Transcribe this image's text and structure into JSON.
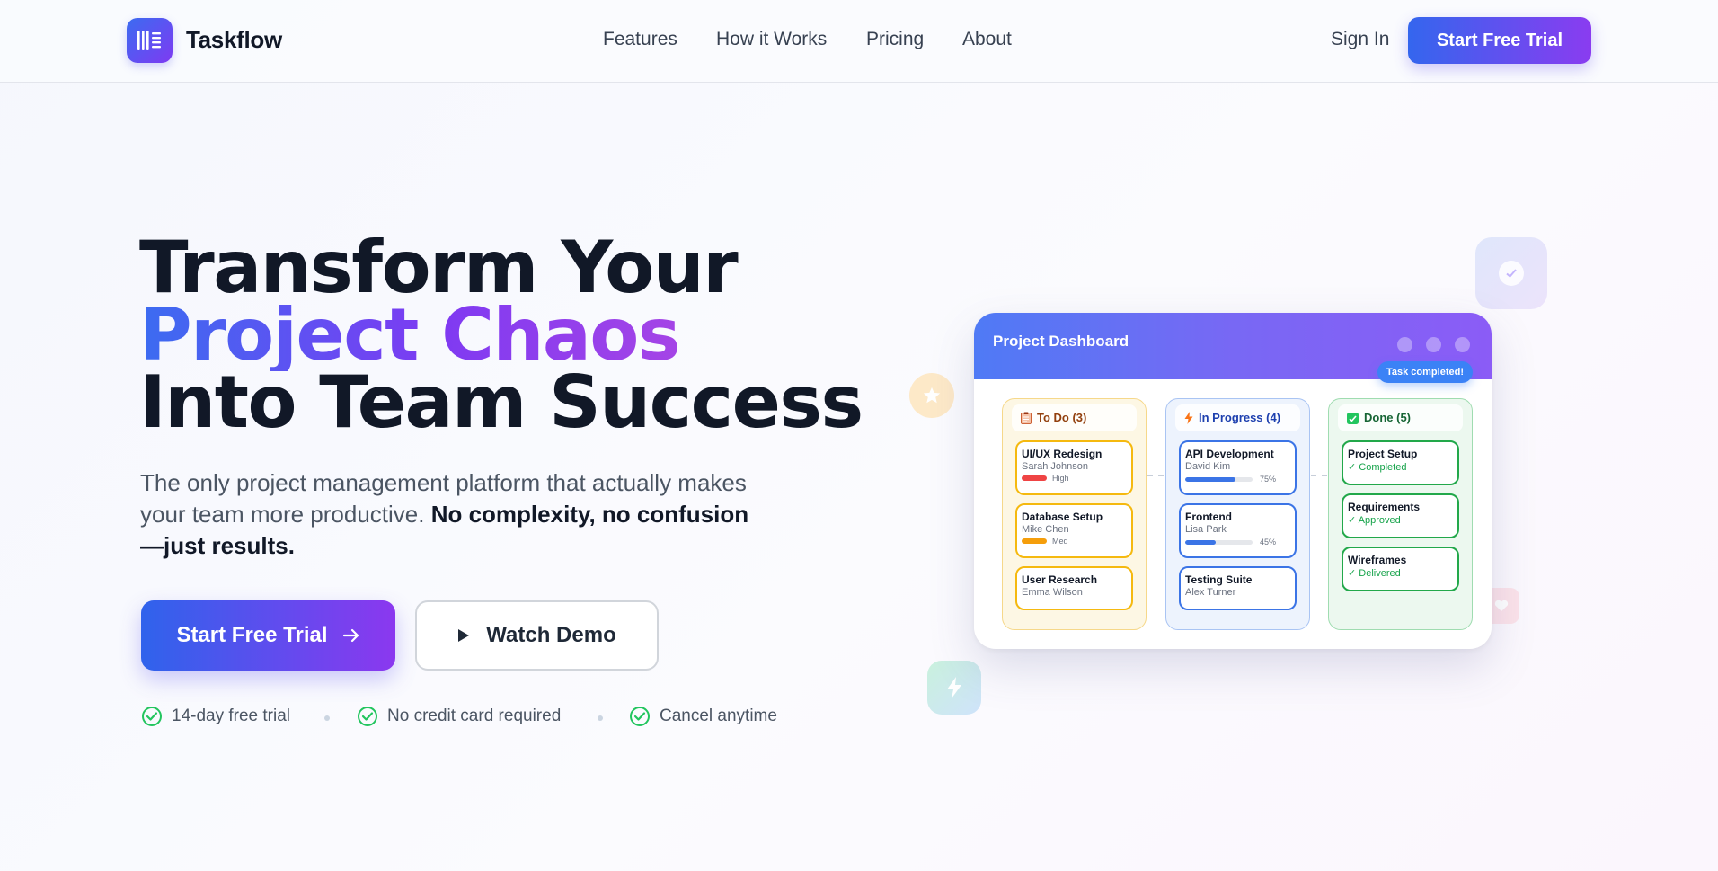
{
  "nav": {
    "brand": "Taskflow",
    "links": [
      "Features",
      "How it Works",
      "Pricing",
      "About"
    ],
    "sign_in": "Sign In",
    "cta": "Start Free Trial"
  },
  "hero": {
    "line1": "Transform Your",
    "line2": "Project Chaos",
    "line3": "Into Team Success",
    "subtitle_plain": "The only project management platform that actually makes your team more productive. ",
    "subtitle_bold": "No complexity, no confusion—just results.",
    "primary_cta": "Start Free Trial",
    "secondary_cta": "Watch Demo",
    "perks": [
      "14-day free trial",
      "No credit card required",
      "Cancel anytime"
    ]
  },
  "dashboard": {
    "title": "Project Dashboard",
    "toast": "Task completed!",
    "columns": {
      "todo": {
        "label": "To Do (3)",
        "cards": [
          {
            "title": "UI/UX Redesign",
            "assignee": "Sarah Johnson",
            "priority": "High",
            "priority_color": "#ef4444"
          },
          {
            "title": "Database Setup",
            "assignee": "Mike Chen",
            "priority": "Med",
            "priority_color": "#f59e0b"
          },
          {
            "title": "User Research",
            "assignee": "Emma Wilson"
          }
        ]
      },
      "progress": {
        "label": "In Progress (4)",
        "cards": [
          {
            "title": "API Development",
            "assignee": "David Kim",
            "progress": 75,
            "progress_label": "75%"
          },
          {
            "title": "Frontend",
            "assignee": "Lisa Park",
            "progress": 45,
            "progress_label": "45%"
          },
          {
            "title": "Testing Suite",
            "assignee": "Alex Turner"
          }
        ]
      },
      "done": {
        "label": "Done (5)",
        "cards": [
          {
            "title": "Project Setup",
            "status": "✓ Completed"
          },
          {
            "title": "Requirements",
            "status": "✓ Approved"
          },
          {
            "title": "Wireframes",
            "status": "✓ Delivered"
          }
        ]
      }
    }
  },
  "colors": {
    "brand_blue": "#3466ee",
    "brand_purple": "#8a3cf0",
    "check_green": "#22c55e"
  }
}
